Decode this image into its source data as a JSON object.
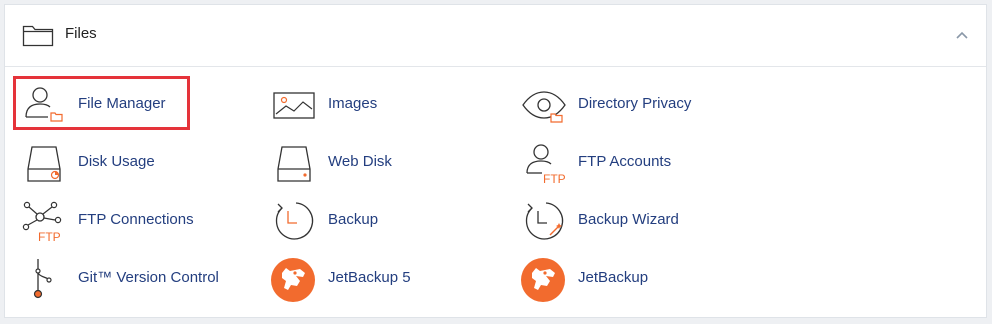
{
  "section": {
    "title": "Files",
    "icon": "folder-icon",
    "collapse_icon": "chevron-up-icon"
  },
  "items": [
    {
      "label": "File Manager",
      "icon": "user-folder-icon"
    },
    {
      "label": "Images",
      "icon": "image-icon"
    },
    {
      "label": "Directory Privacy",
      "icon": "eye-folder-icon"
    },
    {
      "label": "Disk Usage",
      "icon": "disk-chart-icon"
    },
    {
      "label": "Web Disk",
      "icon": "hard-disk-icon"
    },
    {
      "label": "FTP Accounts",
      "icon": "user-ftp-icon",
      "icon_text": "FTP"
    },
    {
      "label": "FTP Connections",
      "icon": "network-ftp-icon",
      "icon_text": "FTP"
    },
    {
      "label": "Backup",
      "icon": "clock-backup-icon"
    },
    {
      "label": "Backup Wizard",
      "icon": "clock-wand-icon"
    },
    {
      "label": "Git™ Version Control",
      "icon": "git-branch-icon"
    },
    {
      "label": "JetBackup 5",
      "icon": "jetbackup-logo-icon"
    },
    {
      "label": "JetBackup",
      "icon": "jetbackup-logo-icon"
    }
  ],
  "colors": {
    "accent": "#f26b2e",
    "link": "#233e7f",
    "highlight": "#e5333a",
    "line": "#333333"
  }
}
